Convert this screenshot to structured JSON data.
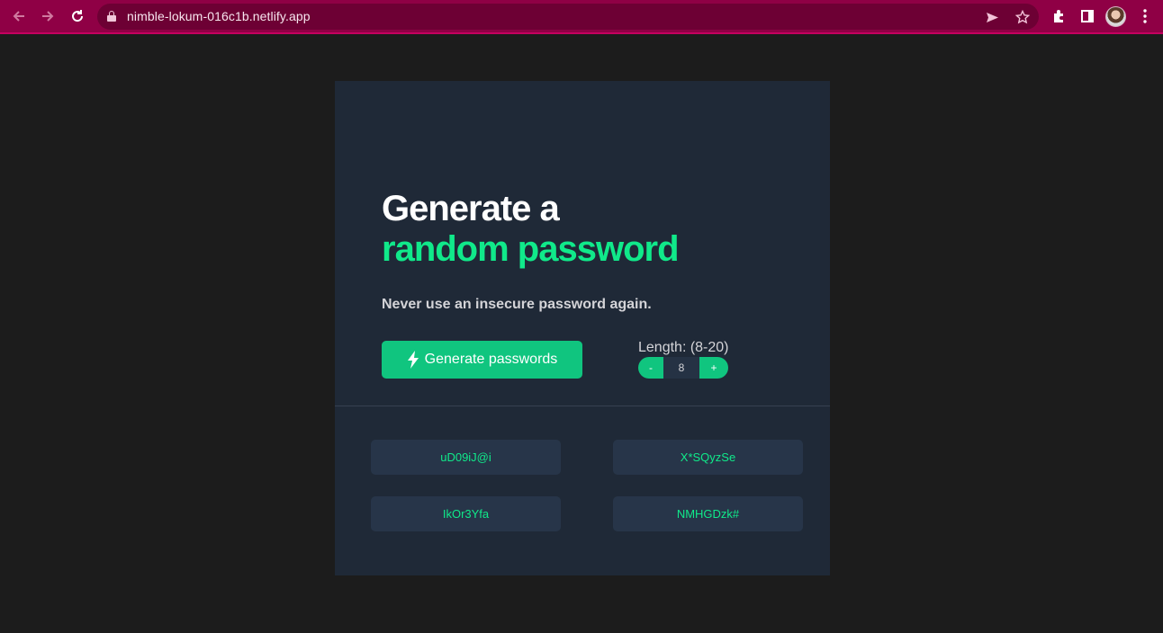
{
  "browser": {
    "url": "nimble-lokum-016c1b.netlify.app",
    "icons": {
      "back": "back-arrow-icon",
      "forward": "forward-arrow-icon",
      "reload": "reload-icon",
      "lock": "lock-icon",
      "send": "send-tab-icon",
      "bookmark": "star-icon",
      "extensions": "puzzle-icon",
      "sidepanel": "side-panel-icon",
      "menu": "kebab-menu-icon"
    },
    "colors": {
      "toolbar": "#8f0045",
      "omnibox": "#6d0034"
    }
  },
  "page": {
    "headline_line1": "Generate a",
    "headline_line2": "random password",
    "subtitle": "Never use an insecure password again.",
    "generate_button": "Generate passwords",
    "length_label": "Length: (8-20)",
    "stepper": {
      "minus": "-",
      "value": "8",
      "plus": "+"
    },
    "passwords": [
      "uD09iJ@i",
      "X*SQyzSe",
      "IkOr3Yfa",
      "NMHGDzk#"
    ],
    "colors": {
      "accent": "#10e98a",
      "button": "#10c57f",
      "card": "#1f2937",
      "background": "#1c1c1c"
    }
  }
}
